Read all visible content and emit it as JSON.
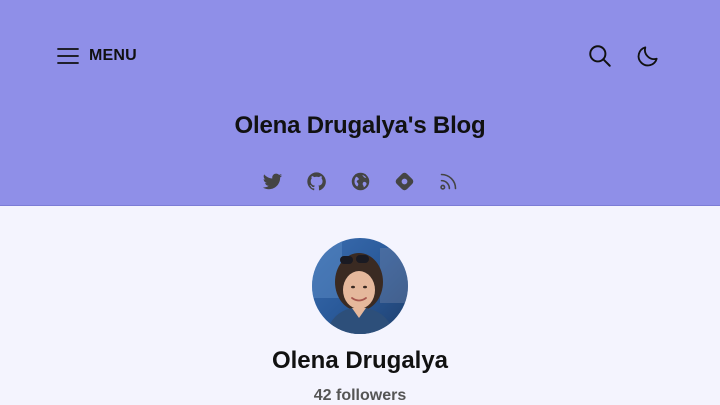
{
  "header": {
    "menu_label": "MENU",
    "blog_title": "Olena Drugalya's Blog",
    "background_color": "#8f8fe8",
    "action_icons": [
      "search-icon",
      "moon-icon"
    ],
    "social_icons": [
      "twitter-icon",
      "github-icon",
      "globe-icon",
      "hashnode-icon",
      "rss-icon"
    ]
  },
  "profile": {
    "name": "Olena Drugalya",
    "followers": "42 followers",
    "avatar": "profile-photo"
  },
  "colors": {
    "page_background": "#f4f4fe",
    "text": "#111111",
    "icon": "#444444"
  }
}
